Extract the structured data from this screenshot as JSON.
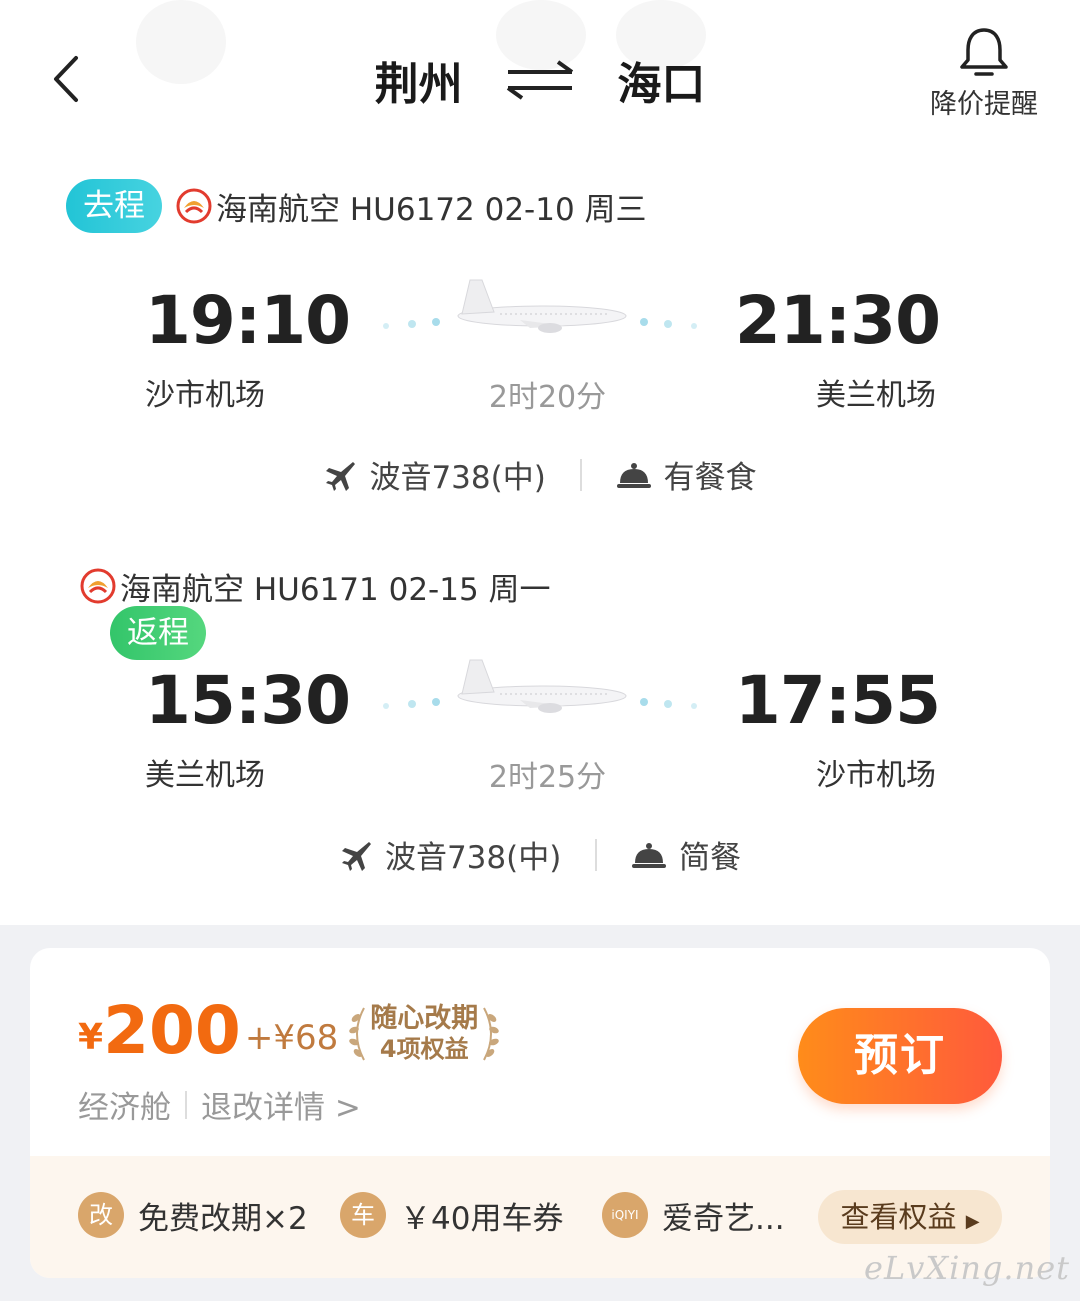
{
  "header": {
    "origin": "荆州",
    "destination": "海口",
    "alert_label": "降价提醒"
  },
  "outbound": {
    "tag": "去程",
    "airline_info": "海南航空 HU6172  02-10 周三",
    "dep_time": "19:10",
    "arr_time": "21:30",
    "dep_airport": "沙市机场",
    "arr_airport": "美兰机场",
    "duration": "2时20分",
    "aircraft": "波音738(中)",
    "meal": "有餐食"
  },
  "return": {
    "tag": "返程",
    "airline_info": "海南航空 HU6171  02-15 周一",
    "dep_time": "15:30",
    "arr_time": "17:55",
    "dep_airport": "美兰机场",
    "arr_airport": "沙市机场",
    "duration": "2时25分",
    "aircraft": "波音738(中)",
    "meal": "简餐"
  },
  "offer": {
    "currency": "¥",
    "price": "200",
    "addon": "+¥68",
    "badge_title": "随心改期",
    "badge_sub": "4项权益",
    "cabin": "经济舱",
    "rules_link": "退改详情 >",
    "book_label": "预订",
    "benefits": [
      {
        "icon_text": "改",
        "label": "免费改期×2"
      },
      {
        "icon_text": "车",
        "label": "￥40用车券"
      },
      {
        "icon_text": "iQIYI",
        "label": "爱奇艺..."
      }
    ],
    "view_label": "查看权益"
  },
  "watermark": "eLvXing.net",
  "colors": {
    "price": "#f26a10",
    "go_tag": "#22c4d6",
    "back_tag": "#33c56a",
    "book_start": "#ff8c1a",
    "book_end": "#ff5a3c"
  }
}
